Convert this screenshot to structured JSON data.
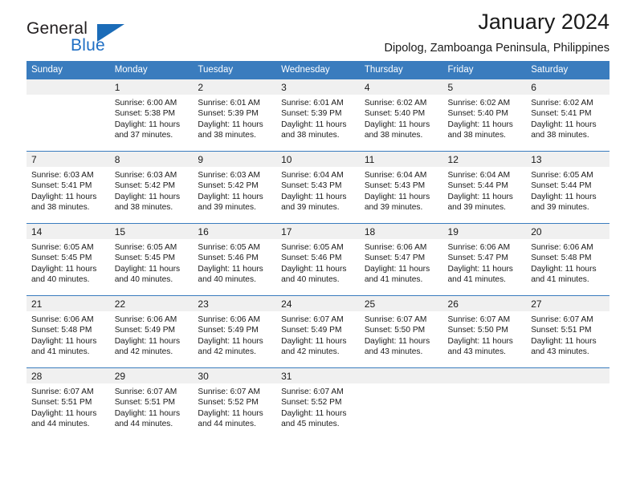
{
  "brand": {
    "name_part1": "General",
    "name_part2": "Blue",
    "triangle_color": "#1b6cb8",
    "blue_text_color": "#1f6fc4"
  },
  "header": {
    "title": "January 2024",
    "subtitle": "Dipolog, Zamboanga Peninsula, Philippines"
  },
  "theme": {
    "header_row_bg": "#3a7cbe",
    "header_row_text": "#ffffff",
    "daynum_band_bg": "#f0f0f0",
    "cell_bg": "#ffffff",
    "row_separator": "#3a7cbe"
  },
  "weekday_headers": [
    "Sunday",
    "Monday",
    "Tuesday",
    "Wednesday",
    "Thursday",
    "Friday",
    "Saturday"
  ],
  "weeks": [
    [
      {
        "day": "",
        "lines": []
      },
      {
        "day": "1",
        "lines": [
          "Sunrise: 6:00 AM",
          "Sunset: 5:38 PM",
          "Daylight: 11 hours",
          "and 37 minutes."
        ]
      },
      {
        "day": "2",
        "lines": [
          "Sunrise: 6:01 AM",
          "Sunset: 5:39 PM",
          "Daylight: 11 hours",
          "and 38 minutes."
        ]
      },
      {
        "day": "3",
        "lines": [
          "Sunrise: 6:01 AM",
          "Sunset: 5:39 PM",
          "Daylight: 11 hours",
          "and 38 minutes."
        ]
      },
      {
        "day": "4",
        "lines": [
          "Sunrise: 6:02 AM",
          "Sunset: 5:40 PM",
          "Daylight: 11 hours",
          "and 38 minutes."
        ]
      },
      {
        "day": "5",
        "lines": [
          "Sunrise: 6:02 AM",
          "Sunset: 5:40 PM",
          "Daylight: 11 hours",
          "and 38 minutes."
        ]
      },
      {
        "day": "6",
        "lines": [
          "Sunrise: 6:02 AM",
          "Sunset: 5:41 PM",
          "Daylight: 11 hours",
          "and 38 minutes."
        ]
      }
    ],
    [
      {
        "day": "7",
        "lines": [
          "Sunrise: 6:03 AM",
          "Sunset: 5:41 PM",
          "Daylight: 11 hours",
          "and 38 minutes."
        ]
      },
      {
        "day": "8",
        "lines": [
          "Sunrise: 6:03 AM",
          "Sunset: 5:42 PM",
          "Daylight: 11 hours",
          "and 38 minutes."
        ]
      },
      {
        "day": "9",
        "lines": [
          "Sunrise: 6:03 AM",
          "Sunset: 5:42 PM",
          "Daylight: 11 hours",
          "and 39 minutes."
        ]
      },
      {
        "day": "10",
        "lines": [
          "Sunrise: 6:04 AM",
          "Sunset: 5:43 PM",
          "Daylight: 11 hours",
          "and 39 minutes."
        ]
      },
      {
        "day": "11",
        "lines": [
          "Sunrise: 6:04 AM",
          "Sunset: 5:43 PM",
          "Daylight: 11 hours",
          "and 39 minutes."
        ]
      },
      {
        "day": "12",
        "lines": [
          "Sunrise: 6:04 AM",
          "Sunset: 5:44 PM",
          "Daylight: 11 hours",
          "and 39 minutes."
        ]
      },
      {
        "day": "13",
        "lines": [
          "Sunrise: 6:05 AM",
          "Sunset: 5:44 PM",
          "Daylight: 11 hours",
          "and 39 minutes."
        ]
      }
    ],
    [
      {
        "day": "14",
        "lines": [
          "Sunrise: 6:05 AM",
          "Sunset: 5:45 PM",
          "Daylight: 11 hours",
          "and 40 minutes."
        ]
      },
      {
        "day": "15",
        "lines": [
          "Sunrise: 6:05 AM",
          "Sunset: 5:45 PM",
          "Daylight: 11 hours",
          "and 40 minutes."
        ]
      },
      {
        "day": "16",
        "lines": [
          "Sunrise: 6:05 AM",
          "Sunset: 5:46 PM",
          "Daylight: 11 hours",
          "and 40 minutes."
        ]
      },
      {
        "day": "17",
        "lines": [
          "Sunrise: 6:05 AM",
          "Sunset: 5:46 PM",
          "Daylight: 11 hours",
          "and 40 minutes."
        ]
      },
      {
        "day": "18",
        "lines": [
          "Sunrise: 6:06 AM",
          "Sunset: 5:47 PM",
          "Daylight: 11 hours",
          "and 41 minutes."
        ]
      },
      {
        "day": "19",
        "lines": [
          "Sunrise: 6:06 AM",
          "Sunset: 5:47 PM",
          "Daylight: 11 hours",
          "and 41 minutes."
        ]
      },
      {
        "day": "20",
        "lines": [
          "Sunrise: 6:06 AM",
          "Sunset: 5:48 PM",
          "Daylight: 11 hours",
          "and 41 minutes."
        ]
      }
    ],
    [
      {
        "day": "21",
        "lines": [
          "Sunrise: 6:06 AM",
          "Sunset: 5:48 PM",
          "Daylight: 11 hours",
          "and 41 minutes."
        ]
      },
      {
        "day": "22",
        "lines": [
          "Sunrise: 6:06 AM",
          "Sunset: 5:49 PM",
          "Daylight: 11 hours",
          "and 42 minutes."
        ]
      },
      {
        "day": "23",
        "lines": [
          "Sunrise: 6:06 AM",
          "Sunset: 5:49 PM",
          "Daylight: 11 hours",
          "and 42 minutes."
        ]
      },
      {
        "day": "24",
        "lines": [
          "Sunrise: 6:07 AM",
          "Sunset: 5:49 PM",
          "Daylight: 11 hours",
          "and 42 minutes."
        ]
      },
      {
        "day": "25",
        "lines": [
          "Sunrise: 6:07 AM",
          "Sunset: 5:50 PM",
          "Daylight: 11 hours",
          "and 43 minutes."
        ]
      },
      {
        "day": "26",
        "lines": [
          "Sunrise: 6:07 AM",
          "Sunset: 5:50 PM",
          "Daylight: 11 hours",
          "and 43 minutes."
        ]
      },
      {
        "day": "27",
        "lines": [
          "Sunrise: 6:07 AM",
          "Sunset: 5:51 PM",
          "Daylight: 11 hours",
          "and 43 minutes."
        ]
      }
    ],
    [
      {
        "day": "28",
        "lines": [
          "Sunrise: 6:07 AM",
          "Sunset: 5:51 PM",
          "Daylight: 11 hours",
          "and 44 minutes."
        ]
      },
      {
        "day": "29",
        "lines": [
          "Sunrise: 6:07 AM",
          "Sunset: 5:51 PM",
          "Daylight: 11 hours",
          "and 44 minutes."
        ]
      },
      {
        "day": "30",
        "lines": [
          "Sunrise: 6:07 AM",
          "Sunset: 5:52 PM",
          "Daylight: 11 hours",
          "and 44 minutes."
        ]
      },
      {
        "day": "31",
        "lines": [
          "Sunrise: 6:07 AM",
          "Sunset: 5:52 PM",
          "Daylight: 11 hours",
          "and 45 minutes."
        ]
      },
      {
        "day": "",
        "lines": []
      },
      {
        "day": "",
        "lines": []
      },
      {
        "day": "",
        "lines": []
      }
    ]
  ]
}
